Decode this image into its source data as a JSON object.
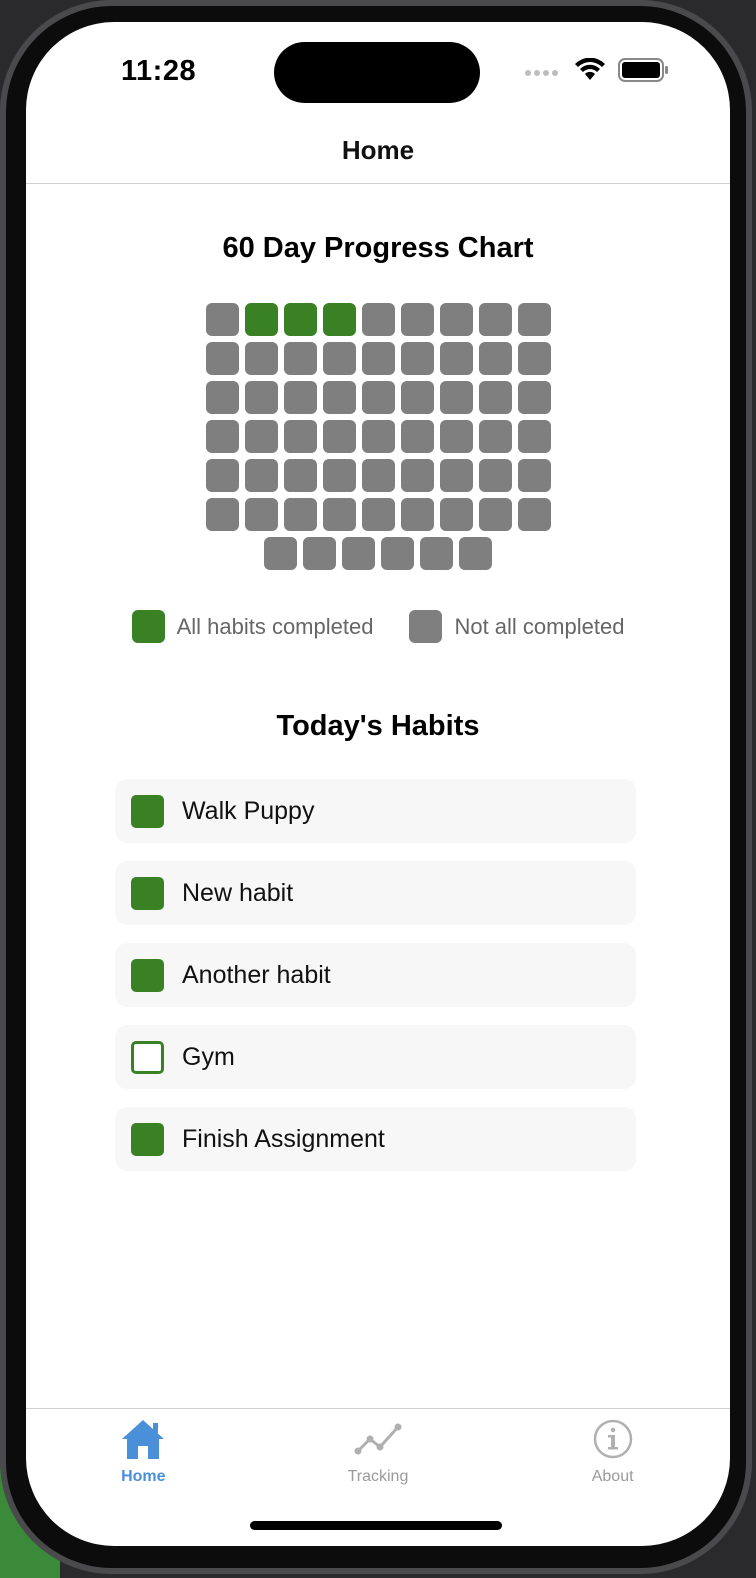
{
  "status_bar": {
    "time": "11:28"
  },
  "nav": {
    "title": "Home"
  },
  "chart_data": {
    "type": "heatmap",
    "title": "60 Day Progress Chart",
    "rows": [
      [
        false,
        true,
        true,
        true,
        false,
        false,
        false,
        false,
        false
      ],
      [
        false,
        false,
        false,
        false,
        false,
        false,
        false,
        false,
        false
      ],
      [
        false,
        false,
        false,
        false,
        false,
        false,
        false,
        false,
        false
      ],
      [
        false,
        false,
        false,
        false,
        false,
        false,
        false,
        false,
        false
      ],
      [
        false,
        false,
        false,
        false,
        false,
        false,
        false,
        false,
        false
      ],
      [
        false,
        false,
        false,
        false,
        false,
        false,
        false,
        false,
        false
      ],
      [
        false,
        false,
        false,
        false,
        false,
        false
      ]
    ],
    "legend": [
      {
        "label": "All habits completed",
        "color": "#398124"
      },
      {
        "label": "Not all completed",
        "color": "#7f7f7f"
      }
    ]
  },
  "habits": {
    "title": "Today's Habits",
    "items": [
      {
        "label": "Walk Puppy",
        "completed": true
      },
      {
        "label": "New habit",
        "completed": true
      },
      {
        "label": "Another habit",
        "completed": true
      },
      {
        "label": "Gym",
        "completed": false
      },
      {
        "label": "Finish Assignment",
        "completed": true
      }
    ]
  },
  "tabs": [
    {
      "label": "Home",
      "icon": "house-icon",
      "active": true
    },
    {
      "label": "Tracking",
      "icon": "chart-line-icon",
      "active": false
    },
    {
      "label": "About",
      "icon": "info-icon",
      "active": false
    }
  ],
  "colors": {
    "accent": "#4a90d9",
    "done": "#398124",
    "not_done": "#7f7f7f",
    "tab_inactive": "#9a9a9a"
  }
}
